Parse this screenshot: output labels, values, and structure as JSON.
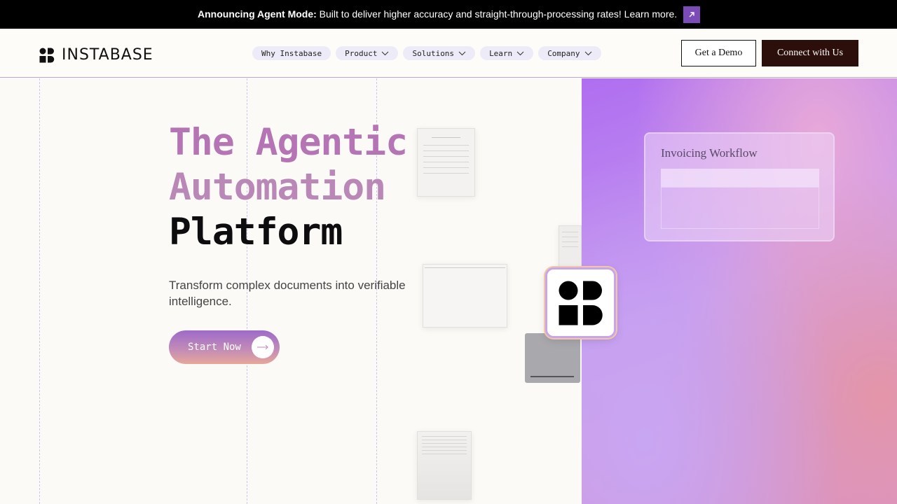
{
  "announcement": {
    "bold": "Announcing Agent Mode:",
    "text": " Built to deliver higher accuracy and straight-through-processing rates! Learn more."
  },
  "brand": {
    "name": "INSTABASE"
  },
  "nav": {
    "items": [
      {
        "label": "Why Instabase",
        "dropdown": false
      },
      {
        "label": "Product",
        "dropdown": true
      },
      {
        "label": "Solutions",
        "dropdown": true
      },
      {
        "label": "Learn",
        "dropdown": true
      },
      {
        "label": "Company",
        "dropdown": true
      }
    ]
  },
  "header": {
    "demo_label": "Get a Demo",
    "connect_label": "Connect with Us"
  },
  "hero": {
    "title_line1": "The Agentic",
    "title_line2": "Automation",
    "title_line3": "Platform",
    "subtitle": "Transform complex documents into verifiable intelligence.",
    "cta_label": "Start Now"
  },
  "workflow_card": {
    "title": "Invoicing Workflow"
  },
  "colors": {
    "announce_bg": "#000000",
    "accent_purple": "#7b4bb8",
    "connect_bg": "#2c0f0a",
    "title_gradient": "#b574b4"
  }
}
